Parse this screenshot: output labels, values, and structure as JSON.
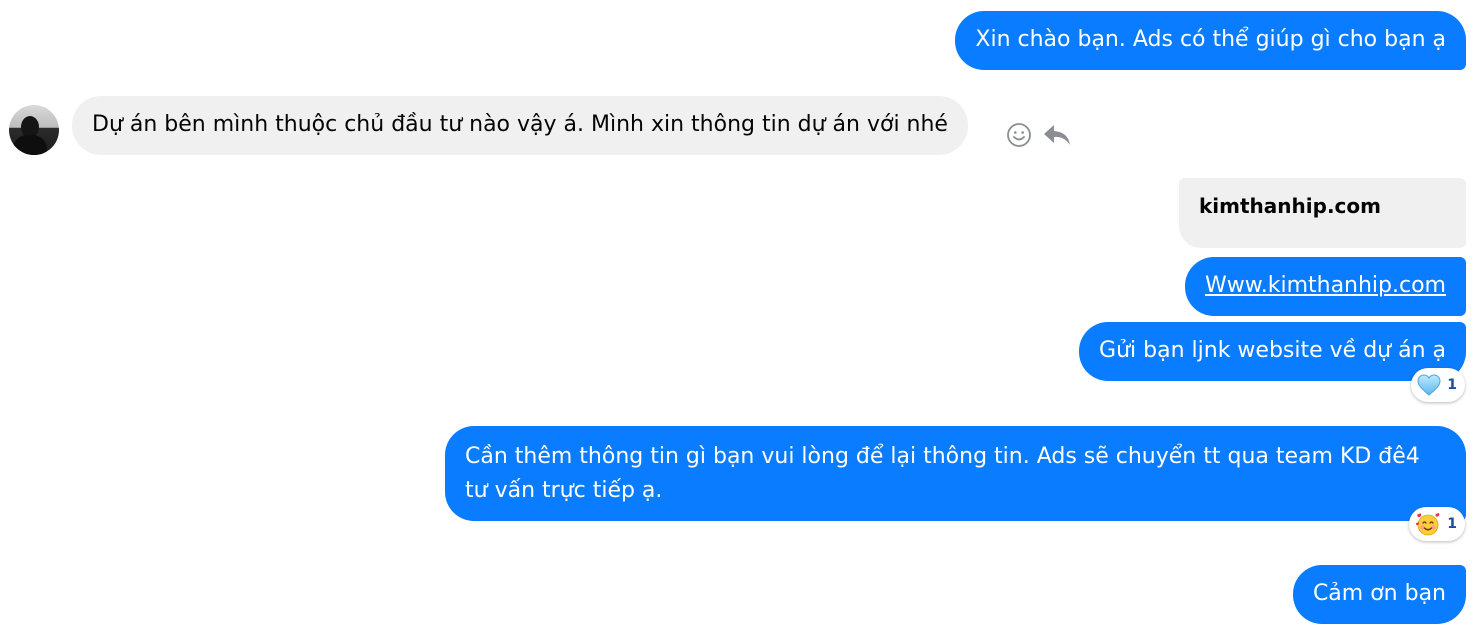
{
  "messages": [
    {
      "id": "msg-1",
      "direction": "outgoing",
      "text": "Xin chào bạn. Ads có thể giúp gì cho bạn ạ"
    },
    {
      "id": "msg-2",
      "direction": "incoming",
      "text": "Dự án bên mình thuộc chủ đầu tư nào vậy á. Mình xin thông tin dự án với nhé"
    },
    {
      "id": "msg-3",
      "direction": "outgoing",
      "text": "kimthanhip.com"
    },
    {
      "id": "msg-4",
      "direction": "outgoing",
      "text": "Www.kimthanhip.com"
    },
    {
      "id": "msg-5",
      "direction": "outgoing",
      "text": "Gửi bạn ljnk website về dự án ạ",
      "reaction": {
        "icon": "light-blue-heart-icon",
        "count": "1"
      }
    },
    {
      "id": "msg-6",
      "direction": "outgoing",
      "text": "Cần thêm thông tin gì bạn vui lòng để lại thông tin. Ads sẽ chuyển tt qua team KD đê4 tư vấn trực tiếp ạ.",
      "reaction": {
        "icon": "smiling-face-with-hearts-icon",
        "count": "1"
      }
    },
    {
      "id": "msg-7",
      "direction": "outgoing",
      "text": "Cảm ơn bạn"
    }
  ],
  "actions": {
    "react_icon": "smiley-face-icon",
    "reply_icon": "reply-arrow-icon"
  },
  "colors": {
    "outgoing_bubble": "#0a7cff",
    "incoming_bubble": "#f0f0f0",
    "link_preview_bubble": "#f0f0f0",
    "reaction_count": "#1c4da1"
  }
}
